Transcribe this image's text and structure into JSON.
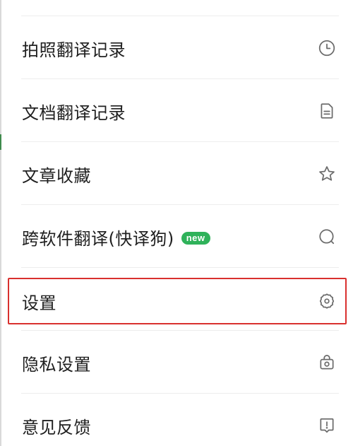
{
  "menu": {
    "items": [
      {
        "label": "拍照翻译记录",
        "icon": "clock-icon"
      },
      {
        "label": "文档翻译记录",
        "icon": "document-icon"
      },
      {
        "label": "文章收藏",
        "icon": "star-icon"
      },
      {
        "label": "跨软件翻译(快译狗)",
        "icon": "search-bubble-icon",
        "badge": "new"
      },
      {
        "label": "设置",
        "icon": "gear-icon",
        "highlighted": true
      },
      {
        "label": "隐私设置",
        "icon": "camera-lock-icon"
      },
      {
        "label": "意见反馈",
        "icon": "feedback-icon"
      }
    ]
  },
  "colors": {
    "text": "#1f1f1f",
    "icon": "#6b6b6b",
    "badge": "#2fb25a",
    "highlight_border": "#d9302e",
    "divider": "#ededed"
  }
}
